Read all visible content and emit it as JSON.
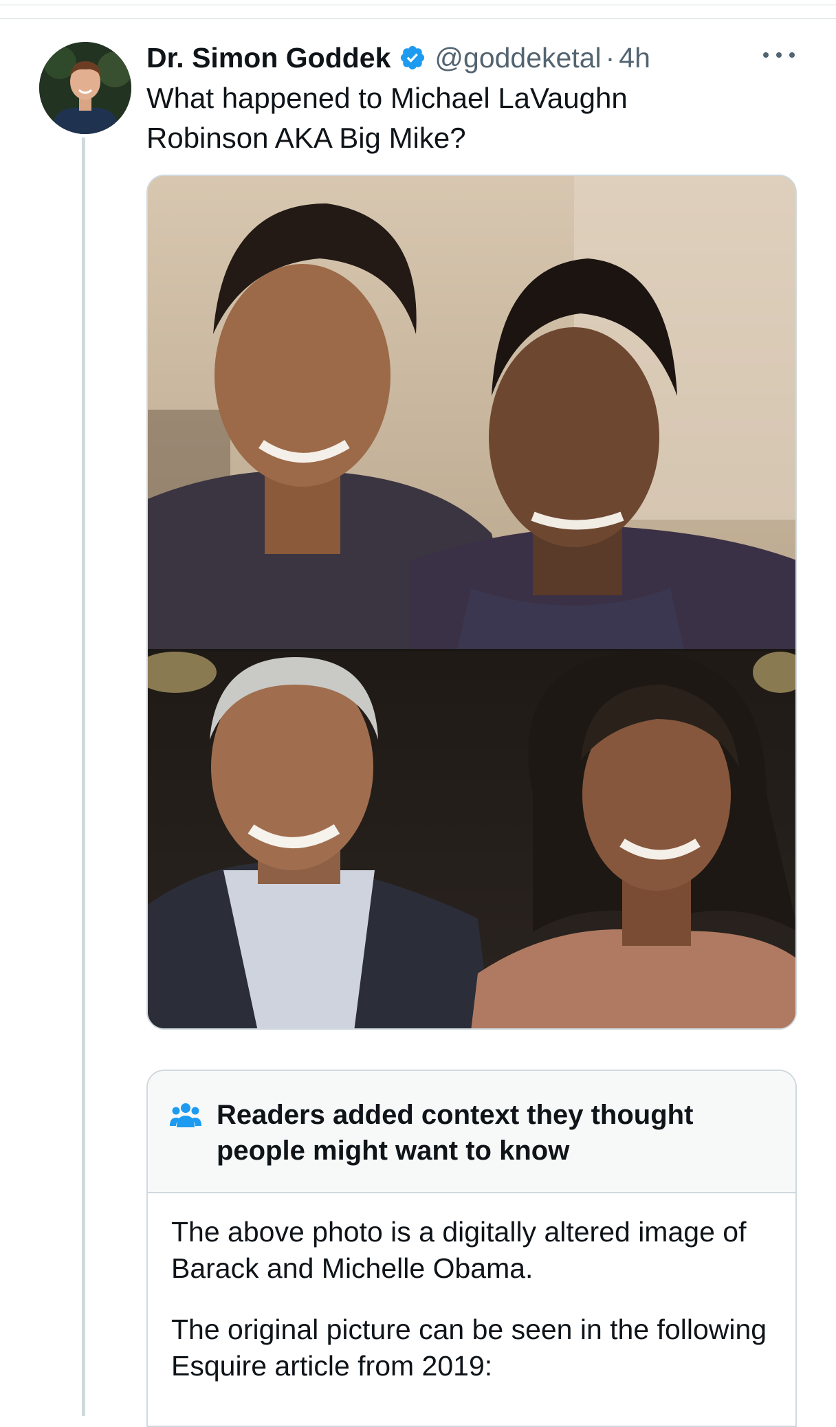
{
  "tweet": {
    "display_name": "Dr. Simon Goddek",
    "handle": "@goddeketal",
    "separator": "·",
    "time": "4h",
    "text": "What happened to Michael LaVaughn Robinson AKA Big Mike?",
    "icons": {
      "verified": "verified-badge-icon",
      "more": "more-options-icon"
    },
    "colors": {
      "verified": "#1d9bf0",
      "secondary_text": "#536471",
      "border": "#cfd9de"
    }
  },
  "note": {
    "header": "Readers added context they thought people might want to know",
    "icon": "people-icon",
    "body_1": "The above photo is a digitally altered image of Barack and Michelle Obama.",
    "body_2": "The original picture can be seen in the following Esquire article from 2019:"
  }
}
